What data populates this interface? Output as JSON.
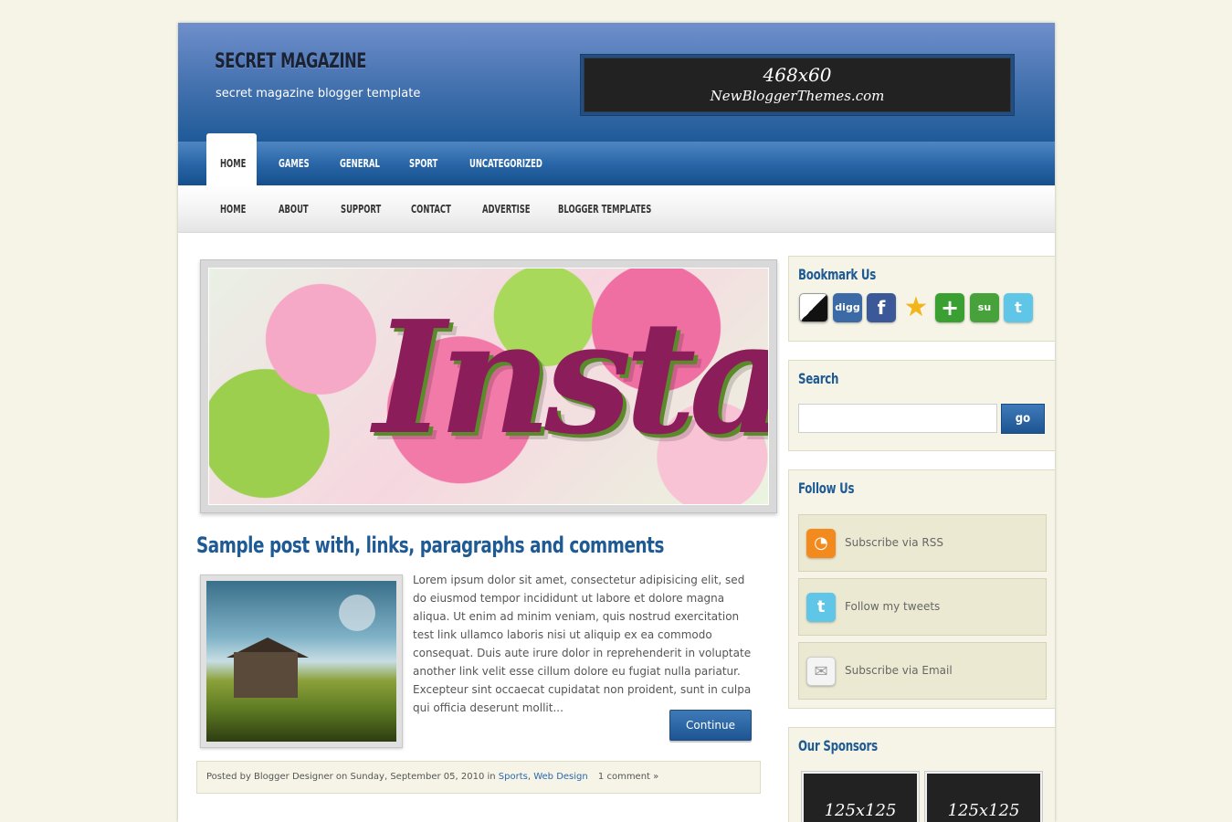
{
  "header": {
    "site_title": "SECRET MAGAZINE",
    "site_description": "secret magazine blogger template",
    "ad_line1": "468x60",
    "ad_line2": "NewBloggerThemes.com"
  },
  "primary_nav": {
    "items": [
      {
        "label": "HOME"
      },
      {
        "label": "GAMES"
      },
      {
        "label": "GENERAL"
      },
      {
        "label": "SPORT"
      },
      {
        "label": "UNCATEGORIZED"
      }
    ]
  },
  "secondary_nav": {
    "items": [
      {
        "label": "HOME"
      },
      {
        "label": "ABOUT"
      },
      {
        "label": "SUPPORT"
      },
      {
        "label": "CONTACT"
      },
      {
        "label": "ADVERTISE"
      },
      {
        "label": "BLOGGER TEMPLATES"
      }
    ]
  },
  "post": {
    "title": "Sample post with, links, paragraphs and comments",
    "excerpt": "Lorem ipsum dolor sit amet, consectetur adipisicing elit, sed do eiusmod tempor incididunt ut labore et dolore magna aliqua. Ut enim ad minim veniam, quis nostrud exercitation test link ullamco laboris nisi ut aliquip ex ea commodo consequat. Duis aute irure dolor in reprehenderit in voluptate another link velit esse cillum dolore eu fugiat nulla pariatur. Excepteur sint occaecat cupidatat non proident, sunt in culpa qui officia deserunt mollit...",
    "continue_label": "Continue",
    "meta_prefix": "Posted by Blogger Designer on Sunday, September 05, 2010 in",
    "category1": "Sports",
    "category2": "Web Design",
    "comments": "1 comment »"
  },
  "sidebar": {
    "bookmark_title": "Bookmark Us",
    "bookmark_icons": [
      {
        "icon": "delicious-icon",
        "glyph": ""
      },
      {
        "icon": "digg-icon",
        "glyph": "digg"
      },
      {
        "icon": "facebook-icon",
        "glyph": "f"
      },
      {
        "icon": "favorites-star-icon",
        "glyph": "★"
      },
      {
        "icon": "google-plus-icon",
        "glyph": "+"
      },
      {
        "icon": "stumbleupon-icon",
        "glyph": "su"
      },
      {
        "icon": "twitter-icon",
        "glyph": "t"
      }
    ],
    "search_title": "Search",
    "search_placeholder": "",
    "search_button": "go",
    "follow_title": "Follow Us",
    "follow_items": [
      {
        "label": "Subscribe via RSS",
        "icon": "rss-icon"
      },
      {
        "label": "Follow my tweets",
        "icon": "twitter-icon"
      },
      {
        "label": "Subscribe via Email",
        "icon": "email-icon"
      }
    ],
    "sponsors_title": "Our Sponsors",
    "sponsor_labels": [
      "125x125",
      "125x125"
    ]
  },
  "colors": {
    "accent": "#1e5a94",
    "header_top": "#6f8fcc",
    "header_bottom": "#1f5a98",
    "page_background": "#f5f4e6"
  }
}
